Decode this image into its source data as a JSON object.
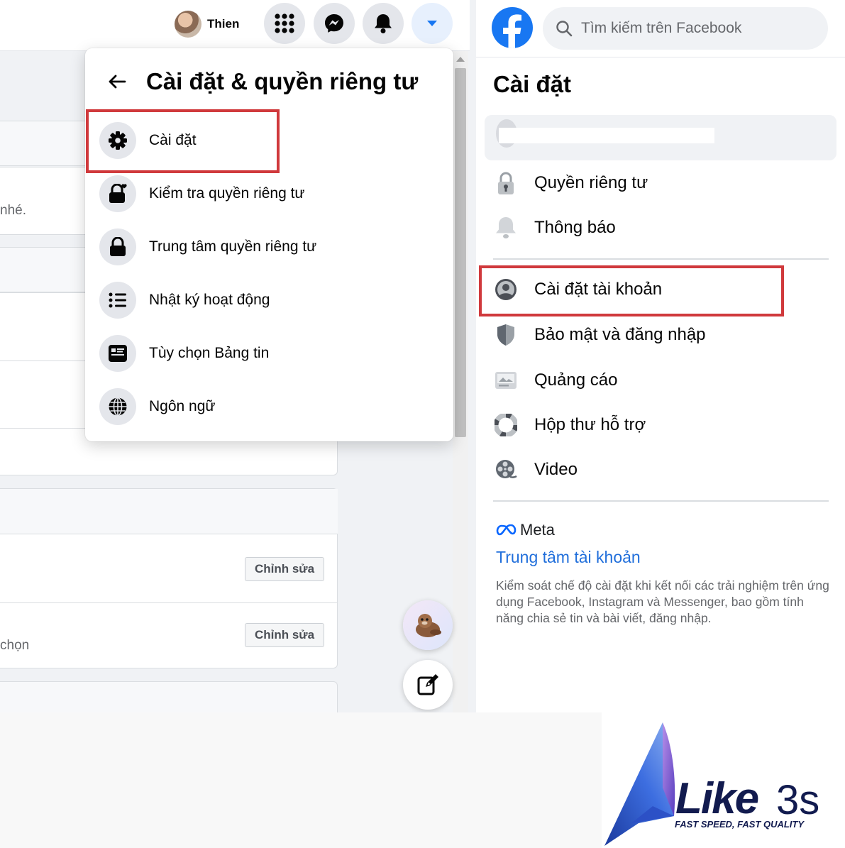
{
  "topbar": {
    "profile_name": "Thien",
    "buttons": [
      "menu-grid",
      "messenger",
      "notifications",
      "account-dropdown"
    ]
  },
  "menu": {
    "title": "Cài đặt & quyền riêng tư",
    "items": [
      {
        "label": "Cài đặt",
        "icon": "gear-icon"
      },
      {
        "label": "Kiểm tra quyền riêng tư",
        "icon": "lock-heart-icon"
      },
      {
        "label": "Trung tâm quyền riêng tư",
        "icon": "lock-icon"
      },
      {
        "label": "Nhật ký hoạt động",
        "icon": "list-icon"
      },
      {
        "label": "Tùy chọn Bảng tin",
        "icon": "feed-icon"
      },
      {
        "label": "Ngôn ngữ",
        "icon": "globe-icon"
      }
    ]
  },
  "background": {
    "text_1": "nhé.",
    "text_2": "chọn",
    "edit_label": "Chỉnh sửa"
  },
  "right": {
    "search_placeholder": "Tìm kiếm trên Facebook",
    "title": "Cài đặt",
    "items": [
      {
        "label": "Quyền riêng tư",
        "icon": "privacy-lock-icon"
      },
      {
        "label": "Thông báo",
        "icon": "bell-icon"
      },
      {
        "label": "Cài đặt tài khoản",
        "icon": "account-icon"
      },
      {
        "label": "Bảo mật và đăng nhập",
        "icon": "shield-icon"
      },
      {
        "label": "Quảng cáo",
        "icon": "ads-icon"
      },
      {
        "label": "Hộp thư hỗ trợ",
        "icon": "lifebuoy-icon"
      },
      {
        "label": "Video",
        "icon": "film-reel-icon"
      }
    ],
    "meta_label": "Meta",
    "account_center": "Trung tâm tài khoản",
    "account_center_desc": "Kiểm soát chế độ cài đặt khi kết nối các trải nghiệm trên ứng dụng Facebook, Instagram và Messenger, bao gồm tính năng chia sẻ tin và bài viết, đăng nhập."
  },
  "brand": {
    "word": "Like",
    "number": "3s",
    "tagline": "FAST SPEED, FAST QUALITY"
  },
  "colors": {
    "highlight": "#d0393c",
    "facebook_blue": "#1877f2",
    "link_blue": "#216fdb",
    "brand_navy": "#121b4f"
  }
}
